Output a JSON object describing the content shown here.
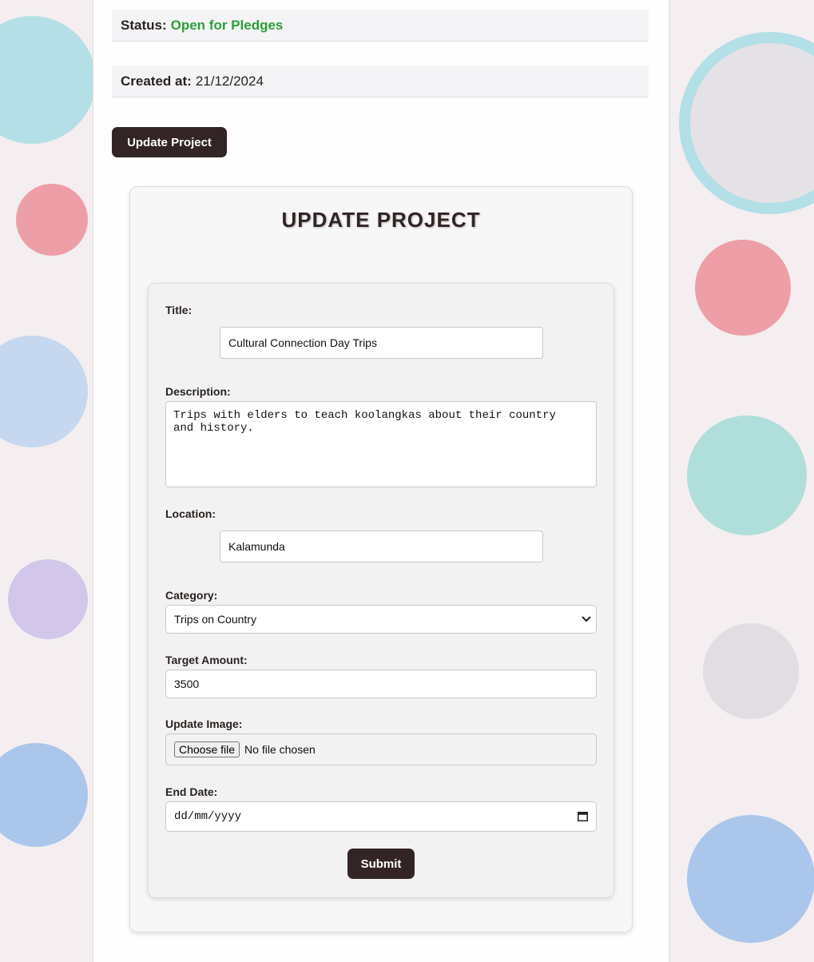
{
  "info": {
    "status_label": "Status:",
    "status_value": "Open for Pledges",
    "created_label": "Created at:",
    "created_value": "21/12/2024"
  },
  "update_button_label": "Update Project",
  "form": {
    "heading": "UPDATE PROJECT",
    "title_label": "Title:",
    "title_value": "Cultural Connection Day Trips",
    "description_label": "Description:",
    "description_value": "Trips with elders to teach koolangkas about their country\nand history.",
    "location_label": "Location:",
    "location_value": "Kalamunda",
    "category_label": "Category:",
    "category_value": "Trips on Country",
    "target_label": "Target Amount:",
    "target_value": "3500",
    "image_label": "Update Image:",
    "choose_file_label": "Choose file",
    "no_file_text": "No file chosen",
    "end_date_label": "End Date:",
    "end_date_placeholder": "dd/mm/yyyy",
    "submit_label": "Submit"
  },
  "colors": {
    "accent_dark": "#332525",
    "status_green": "#2e9e3a"
  }
}
